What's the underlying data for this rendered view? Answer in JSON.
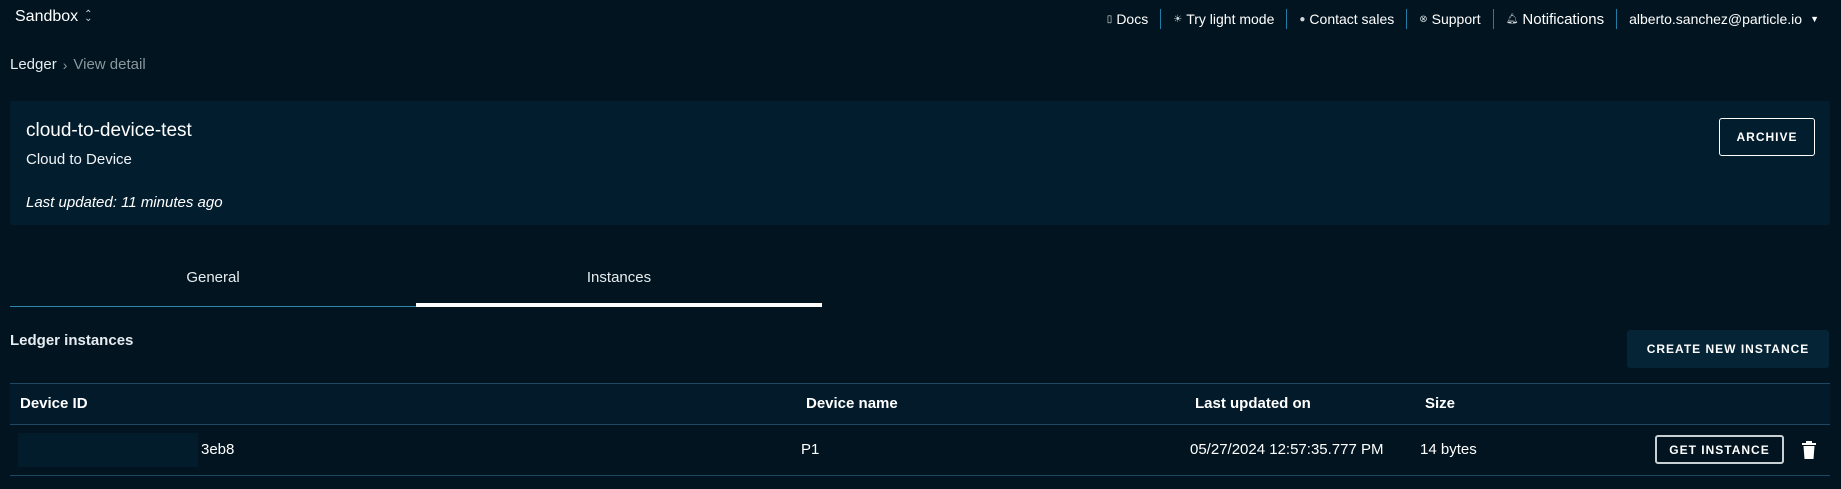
{
  "topbar": {
    "org_name": "Sandbox",
    "nav": {
      "docs": "Docs",
      "light_mode": "Try light mode",
      "contact_sales": "Contact sales",
      "support": "Support",
      "notifications": "Notifications",
      "user_email": "alberto.sanchez@particle.io"
    }
  },
  "breadcrumb": {
    "root": "Ledger",
    "current": "View detail"
  },
  "ledger": {
    "name": "cloud-to-device-test",
    "type": "Cloud to Device",
    "last_updated": "Last updated: 11 minutes ago",
    "archive_label": "ARCHIVE"
  },
  "tabs": [
    {
      "label": "General",
      "active": false
    },
    {
      "label": "Instances",
      "active": true
    }
  ],
  "instances": {
    "title": "Ledger instances",
    "create_label": "CREATE NEW INSTANCE",
    "columns": {
      "device_id": "Device ID",
      "device_name": "Device name",
      "last_updated_on": "Last updated on",
      "size": "Size"
    },
    "rows": [
      {
        "device_id": "3eb8",
        "device_name": "P1",
        "last_updated_on": "05/27/2024 12:57:35.777 PM",
        "size": "14 bytes",
        "action_label": "GET INSTANCE"
      }
    ]
  },
  "colors": {
    "background": "#01141f",
    "card": "#021d2e",
    "accent": "#2e86ad"
  }
}
